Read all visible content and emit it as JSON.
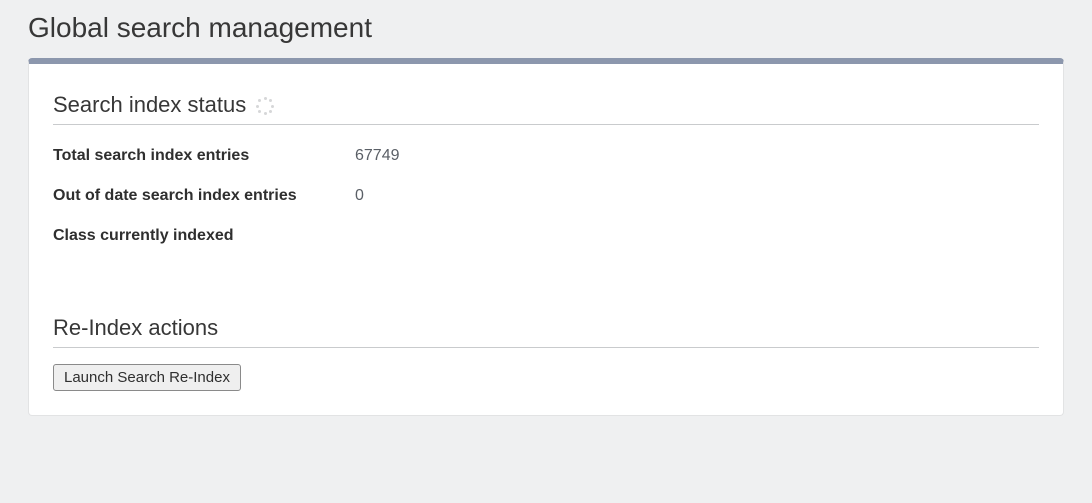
{
  "page": {
    "title": "Global search management"
  },
  "status_section": {
    "heading": "Search index status",
    "rows": {
      "total": {
        "label": "Total search index entries",
        "value": "67749"
      },
      "out_of_date": {
        "label": "Out of date search index entries",
        "value": "0"
      },
      "class_indexed": {
        "label": "Class currently indexed",
        "value": ""
      }
    }
  },
  "reindex_section": {
    "heading": "Re-Index actions",
    "button_label": "Launch Search Re-Index"
  }
}
